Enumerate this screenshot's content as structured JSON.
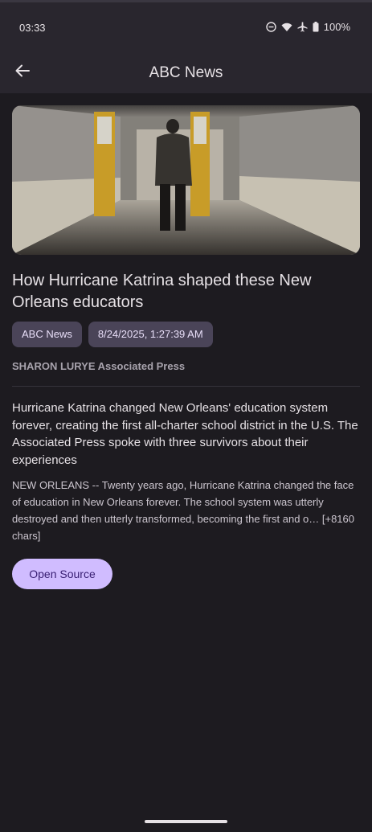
{
  "status_bar": {
    "time": "03:33",
    "battery": "100%",
    "icons": [
      "do-not-disturb-icon",
      "wifi-icon",
      "airplane-icon",
      "battery-icon"
    ]
  },
  "app_bar": {
    "title": "ABC News",
    "back_icon": "arrow-left-icon"
  },
  "article": {
    "hero_image": "school-hallway-photo",
    "headline": "How Hurricane Katrina shaped these New Orleans educators",
    "source_chip": "ABC News",
    "date_chip": "8/24/2025, 1:27:39 AM",
    "author": "SHARON LURYE Associated Press",
    "summary": "Hurricane Katrina changed New Orleans' education system forever, creating the first all-charter school district in the U.S. The Associated Press spoke with three survivors about their experiences",
    "body": "NEW ORLEANS -- Twenty years ago, Hurricane Katrina changed the face of education in New Orleans forever. The school system was utterly destroyed and then utterly transformed, becoming the first and o… [+8160 chars]",
    "open_button": "Open Source"
  },
  "colors": {
    "background": "#1d1b20",
    "app_bar": "#29262e",
    "chip": "#4a4458",
    "primary_button": "#d0bcff"
  }
}
